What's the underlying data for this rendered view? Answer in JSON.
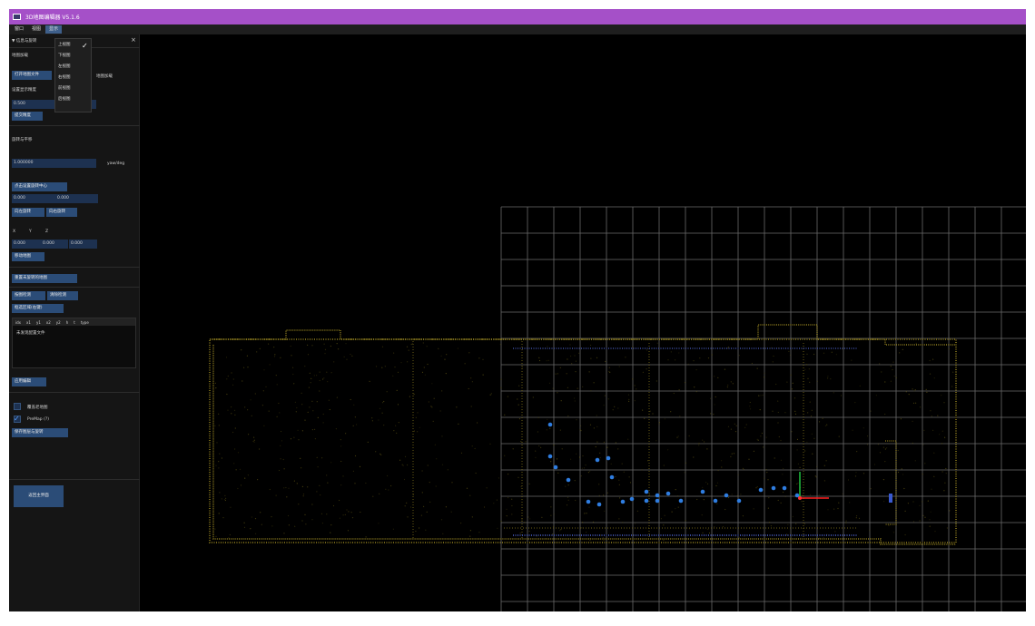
{
  "window": {
    "title": "3D地图编辑器 V5.1.6"
  },
  "menu": {
    "items": [
      "窗口",
      "视图",
      "显示"
    ],
    "active_index": 2
  },
  "colors": {
    "titlebar": "#a550c8",
    "button": "#2b4c77",
    "input": "#1d3150",
    "pointcloud": "#8a7a1e",
    "path": "#2f7de0"
  },
  "panel": {
    "header": "▼ 信息与旋转",
    "close_glyph": "×",
    "map_load_label": "地图加载",
    "open_map_button": "打开地图文件",
    "open_map_hint": "地图加载",
    "resolution_label": "设置显示精度",
    "resolution_value": "0.500",
    "submit_button": "提交精度",
    "rotate_section_label": "旋转与平移",
    "rotate_value": "1.000000",
    "rotate_unit": "yaw/deg",
    "set_center_button": "点击设置旋转中心",
    "center_x": "0.000",
    "center_y": "0.000",
    "rotate_left_button": "向左旋转",
    "rotate_right_button": "向右旋转",
    "axis_x": "X",
    "axis_y": "Y",
    "axis_z": "Z",
    "move_x": "0.000",
    "move_y": "0.000",
    "move_z": "0.000",
    "move_button": "移动地图",
    "reset_button": "重置未旋转的地图",
    "edit_map_button": "按图检测",
    "clear_map_button": "清除检测",
    "region_button": "框选区域(右键)",
    "table_headers": [
      "idx",
      "x1",
      "y1",
      "x2",
      "y2",
      "h",
      "t",
      "type"
    ],
    "table_empty": "未发现配置文件",
    "apply_button": "应用编辑",
    "overlay_label": "覆盖老地图",
    "premap_label": "PreMap (?)",
    "save_button": "保存图层与旋转",
    "back_button": "返回主界面"
  },
  "view_menu": {
    "items": [
      "上视图",
      "下视图",
      "左视图",
      "右视图",
      "前视图",
      "后视图"
    ],
    "checked_index": 0,
    "check_glyph": "✓"
  }
}
